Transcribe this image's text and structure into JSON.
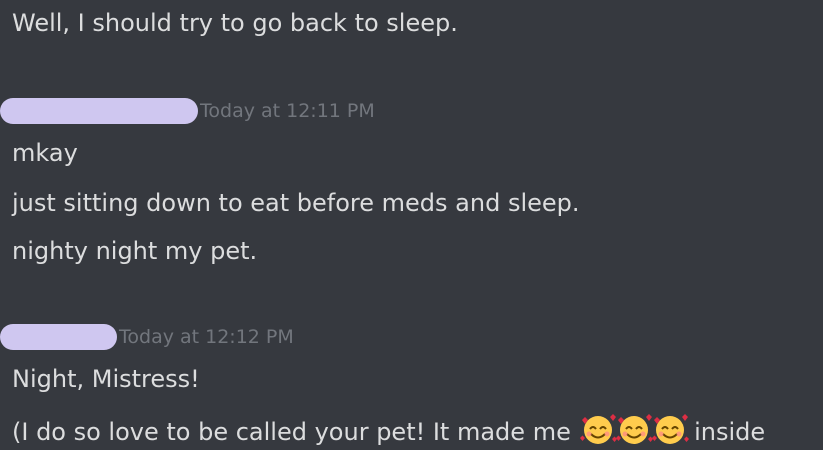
{
  "messages": {
    "prev_line": "Well, I should try to go back to sleep.",
    "group1": {
      "timestamp": "Today at 12:11 PM",
      "lines": [
        "mkay",
        "just sitting down to eat before meds and sleep.",
        "nighty night my pet."
      ]
    },
    "group2": {
      "timestamp": "Today at 12:12 PM",
      "line1": "Night, Mistress!",
      "line2_prefix": "(I do so love to be called your pet! It made me ",
      "line2_suffix": " inside"
    }
  },
  "icons": {
    "emoji": "smiling-face-with-hearts-icon"
  },
  "colors": {
    "background": "#36393f",
    "text": "#dcddde",
    "timestamp": "#72767d",
    "redaction": "#cfc7f0"
  }
}
